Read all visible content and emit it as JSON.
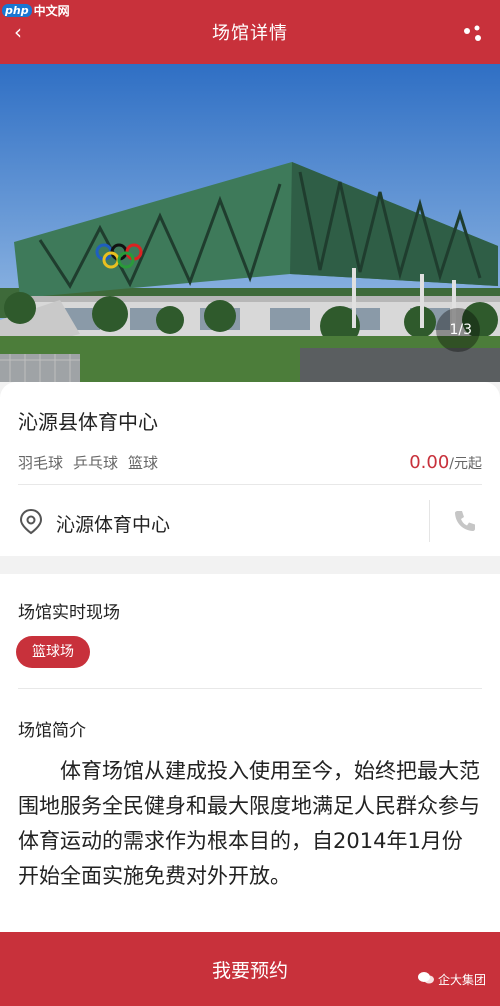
{
  "watermark_top": {
    "badge": "php",
    "site": "中文网"
  },
  "header": {
    "title": "场馆详情"
  },
  "hero": {
    "pager": "1/3"
  },
  "venue": {
    "name": "沁源县体育中心",
    "tags": [
      "羽毛球",
      "乒乓球",
      "篮球"
    ],
    "price_value": "0.00",
    "price_unit": "/元起",
    "location": "沁源体育中心"
  },
  "live": {
    "title": "场馆实时现场",
    "chip": "篮球场"
  },
  "intro": {
    "title": "场馆简介",
    "text": "体育场馆从建成投入使用至今，始终把最大范围地服务全民健身和最大限度地满足人民群众参与体育运动的需求作为根本目的，自2014年1月份开始全面实施免费对外开放。"
  },
  "bottom": {
    "book_label": "我要预约"
  },
  "watermark_bottom": {
    "text": "企大集团"
  },
  "colors": {
    "brand": "#c8313b",
    "price": "#c8313b"
  }
}
